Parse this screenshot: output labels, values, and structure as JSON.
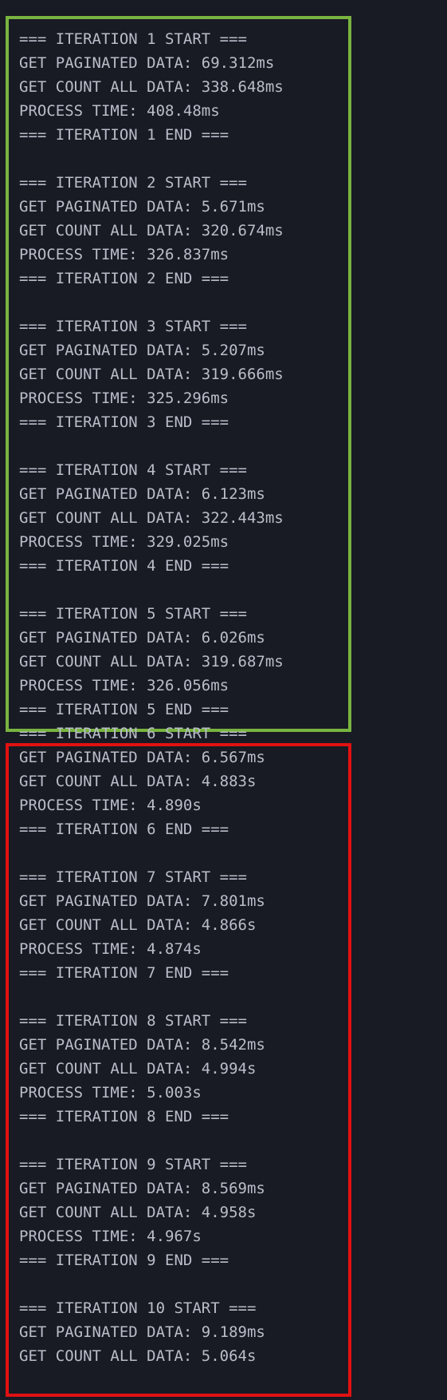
{
  "highlight": {
    "green_box_color": "#78b43f",
    "red_box_color": "#e11111"
  },
  "terminal": {
    "background_color": "#181a24",
    "text_color": "#b9bec9",
    "lines": [
      "=== ITERATION 1 START ===",
      "GET PAGINATED DATA: 69.312ms",
      "GET COUNT ALL DATA: 338.648ms",
      "PROCESS TIME: 408.48ms",
      "=== ITERATION 1 END ===",
      "",
      "=== ITERATION 2 START ===",
      "GET PAGINATED DATA: 5.671ms",
      "GET COUNT ALL DATA: 320.674ms",
      "PROCESS TIME: 326.837ms",
      "=== ITERATION 2 END ===",
      "",
      "=== ITERATION 3 START ===",
      "GET PAGINATED DATA: 5.207ms",
      "GET COUNT ALL DATA: 319.666ms",
      "PROCESS TIME: 325.296ms",
      "=== ITERATION 3 END ===",
      "",
      "=== ITERATION 4 START ===",
      "GET PAGINATED DATA: 6.123ms",
      "GET COUNT ALL DATA: 322.443ms",
      "PROCESS TIME: 329.025ms",
      "=== ITERATION 4 END ===",
      "",
      "=== ITERATION 5 START ===",
      "GET PAGINATED DATA: 6.026ms",
      "GET COUNT ALL DATA: 319.687ms",
      "PROCESS TIME: 326.056ms",
      "=== ITERATION 5 END ===",
      "=== ITERATION 6 START ===",
      "GET PAGINATED DATA: 6.567ms",
      "GET COUNT ALL DATA: 4.883s",
      "PROCESS TIME: 4.890s",
      "=== ITERATION 6 END ===",
      "",
      "=== ITERATION 7 START ===",
      "GET PAGINATED DATA: 7.801ms",
      "GET COUNT ALL DATA: 4.866s",
      "PROCESS TIME: 4.874s",
      "=== ITERATION 7 END ===",
      "",
      "=== ITERATION 8 START ===",
      "GET PAGINATED DATA: 8.542ms",
      "GET COUNT ALL DATA: 4.994s",
      "PROCESS TIME: 5.003s",
      "=== ITERATION 8 END ===",
      "",
      "=== ITERATION 9 START ===",
      "GET PAGINATED DATA: 8.569ms",
      "GET COUNT ALL DATA: 4.958s",
      "PROCESS TIME: 4.967s",
      "=== ITERATION 9 END ===",
      "",
      "=== ITERATION 10 START ===",
      "GET PAGINATED DATA: 9.189ms",
      "GET COUNT ALL DATA: 5.064s"
    ]
  }
}
